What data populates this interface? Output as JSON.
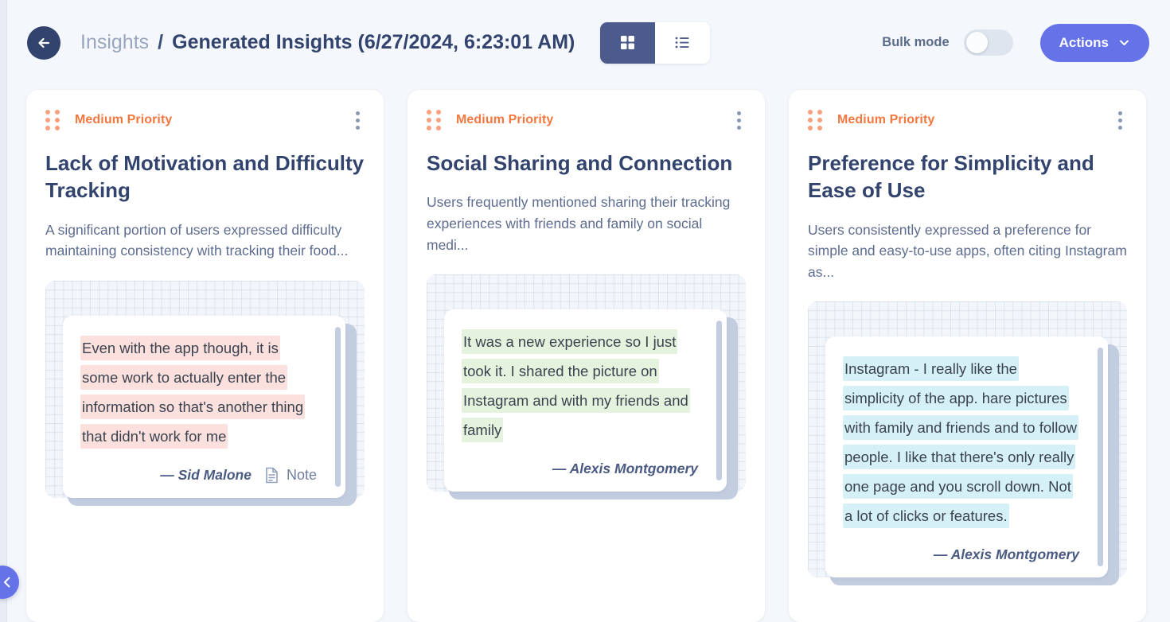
{
  "left_rail": {
    "toggle_icon": "chevron-left-icon"
  },
  "header": {
    "back_icon": "arrow-left-icon",
    "breadcrumb": {
      "parent": "Insights",
      "separator": "/",
      "current": "Generated Insights (6/27/2024, 6:23:01 AM)"
    },
    "view_toggle": {
      "grid_icon": "grid-view-icon",
      "list_icon": "list-view-icon",
      "active": "grid"
    },
    "bulk_mode": {
      "label": "Bulk mode",
      "state": "off"
    },
    "actions": {
      "label": "Actions",
      "chevron_icon": "chevron-down-icon"
    }
  },
  "theme": {
    "accent_purple": "#6572e8",
    "dark_navy": "#32436e",
    "priority_orange": "#f4773f",
    "page_bg": "#f4f7fb"
  },
  "cards": [
    {
      "priority": "Medium Priority",
      "title": "Lack of Motivation and Difficulty Tracking",
      "summary": "A significant portion of users expressed difficulty maintaining consistency with tracking their food...",
      "highlight": "pink",
      "quote": "Even with the app though,  it is some work to actually enter the information so that's another thing that didn't work for me",
      "author": "— Sid Malone",
      "source_label": "Note",
      "source_icon": "document-icon",
      "drag_icon": "drag-handle-icon",
      "menu_icon": "kebab-menu-icon"
    },
    {
      "priority": "Medium Priority",
      "title": "Social Sharing and Connection",
      "summary": "Users frequently mentioned sharing their tracking experiences with friends and family on social medi...",
      "highlight": "green",
      "quote": "It was a new experience so I just took it. I shared the picture on Instagram and with my friends and family",
      "author": "— Alexis Montgomery",
      "source_label": "",
      "source_icon": "",
      "drag_icon": "drag-handle-icon",
      "menu_icon": "kebab-menu-icon"
    },
    {
      "priority": "Medium Priority",
      "title": "Preference for Simplicity and Ease of Use",
      "summary": "Users consistently expressed a preference for simple and easy-to-use apps, often citing Instagram as...",
      "highlight": "blue",
      "quote": "Instagram  - I really like the simplicity of the app. hare pictures with family and friends and to follow people. I like that there's only really one page and you scroll down. Not a lot of clicks or features.",
      "author": "— Alexis Montgomery",
      "source_label": "",
      "source_icon": "",
      "drag_icon": "drag-handle-icon",
      "menu_icon": "kebab-menu-icon"
    }
  ]
}
